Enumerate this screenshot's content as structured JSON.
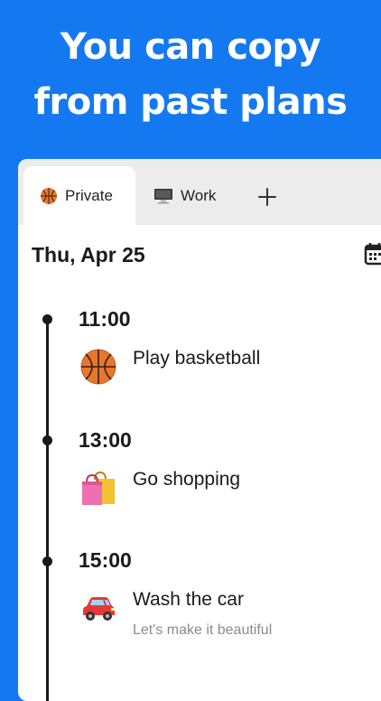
{
  "headline": {
    "line1": "You can copy",
    "line2": "from past plans"
  },
  "tabs": [
    {
      "label": "Private",
      "icon": "basketball-icon"
    },
    {
      "label": "Work",
      "icon": "computer-icon"
    }
  ],
  "add_tab_icon": "plus-icon",
  "date": "Thu, Apr 25",
  "calendar_icon": "calendar-icon",
  "events": [
    {
      "time": "11:00",
      "title": "Play basketball",
      "icon": "basketball-icon"
    },
    {
      "time": "13:00",
      "title": "Go shopping",
      "icon": "shopping-bags-icon"
    },
    {
      "time": "15:00",
      "title": "Wash the car",
      "subtitle": "Let's make it beautiful",
      "icon": "car-icon"
    }
  ]
}
